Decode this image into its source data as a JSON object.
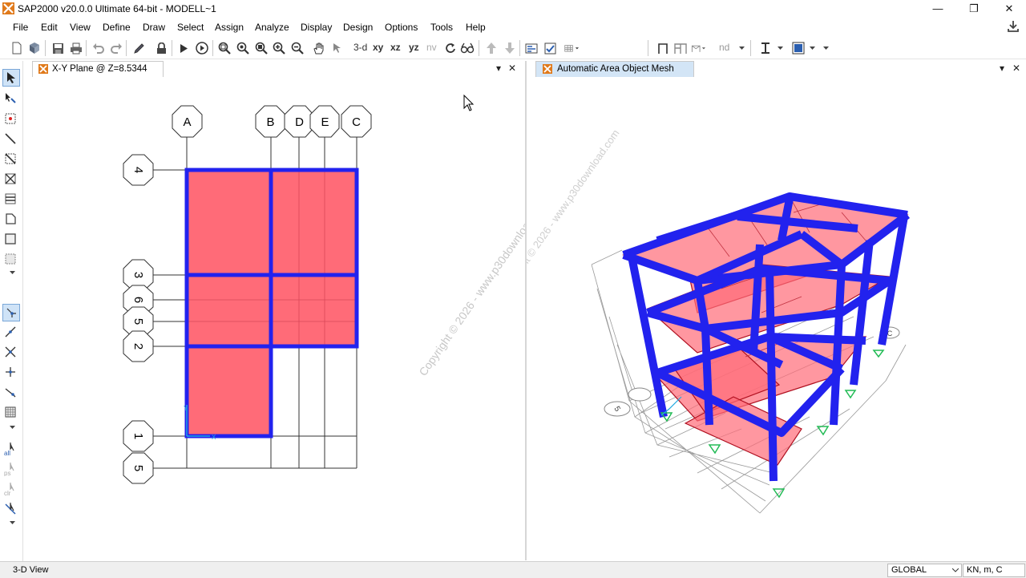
{
  "window": {
    "title": "SAP2000 v20.0.0 Ultimate 64-bit - MODELL~1"
  },
  "menu": [
    "File",
    "Edit",
    "View",
    "Define",
    "Draw",
    "Select",
    "Assign",
    "Analyze",
    "Display",
    "Design",
    "Options",
    "Tools",
    "Help"
  ],
  "toolbar": {
    "view_3d": "3-d",
    "view_xy": "xy",
    "view_xz": "xz",
    "view_yz": "yz",
    "view_nv": "nv",
    "nd": "nd"
  },
  "left_panel": {
    "tab_title": "X-Y Plane @ Z=8.5344",
    "grid_x": [
      "A",
      "B",
      "D",
      "E",
      "C"
    ],
    "grid_y": [
      "4",
      "3",
      "6",
      "5",
      "2",
      "1",
      "5"
    ],
    "axis_x": "X",
    "axis_y": "Y"
  },
  "right_panel": {
    "tab_title": "Automatic Area Object Mesh",
    "grid_labels": [
      "5",
      "C"
    ]
  },
  "watermark": "Copyright © 2026 - www.p30download.com",
  "status": {
    "view_text": "3-D View",
    "coord_system": "GLOBAL",
    "units": "KN, m, C"
  },
  "colors": {
    "frame": "#2222ee",
    "area_fill": "#ff6b78",
    "area_edge": "#b01020",
    "active_tab": "#d3e5f6",
    "restraint": "#22bb55"
  }
}
